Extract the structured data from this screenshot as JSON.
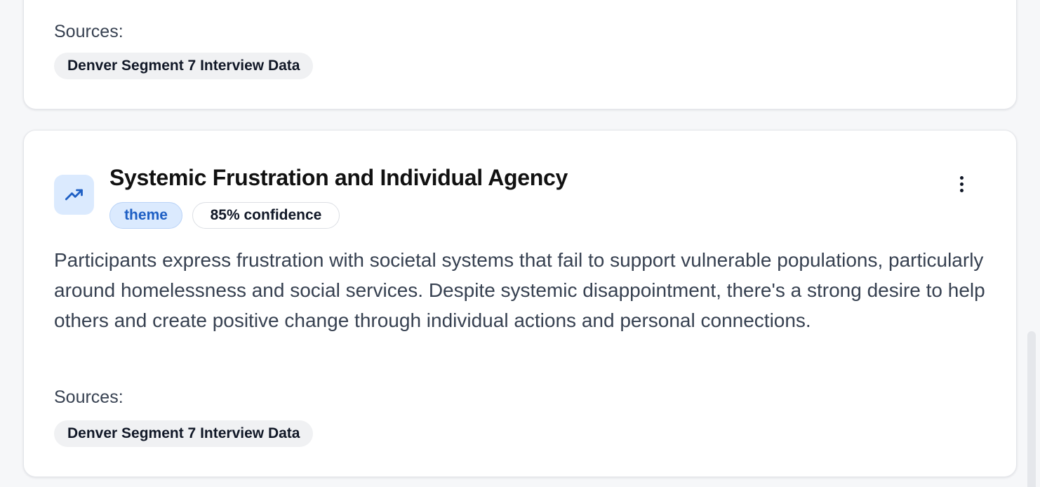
{
  "previous_insight": {
    "sources_label": "Sources:",
    "sources": [
      "Denver Segment 7 Interview Data"
    ]
  },
  "insight": {
    "icon": "trending-up-icon",
    "title": "Systemic Frustration and Individual Agency",
    "type_badge": "theme",
    "confidence_badge": "85% confidence",
    "description": "Participants express frustration with societal systems that fail to support vulnerable populations, particularly around homelessness and social services. Despite systemic disappointment, there's a strong desire to help others and create positive change through individual actions and personal connections.",
    "sources_label": "Sources:",
    "sources": [
      "Denver Segment 7 Interview Data"
    ]
  },
  "colors": {
    "accent": "#1e5fc4",
    "accent_bg": "#dbeafe",
    "page_bg": "#f6f7f9"
  }
}
